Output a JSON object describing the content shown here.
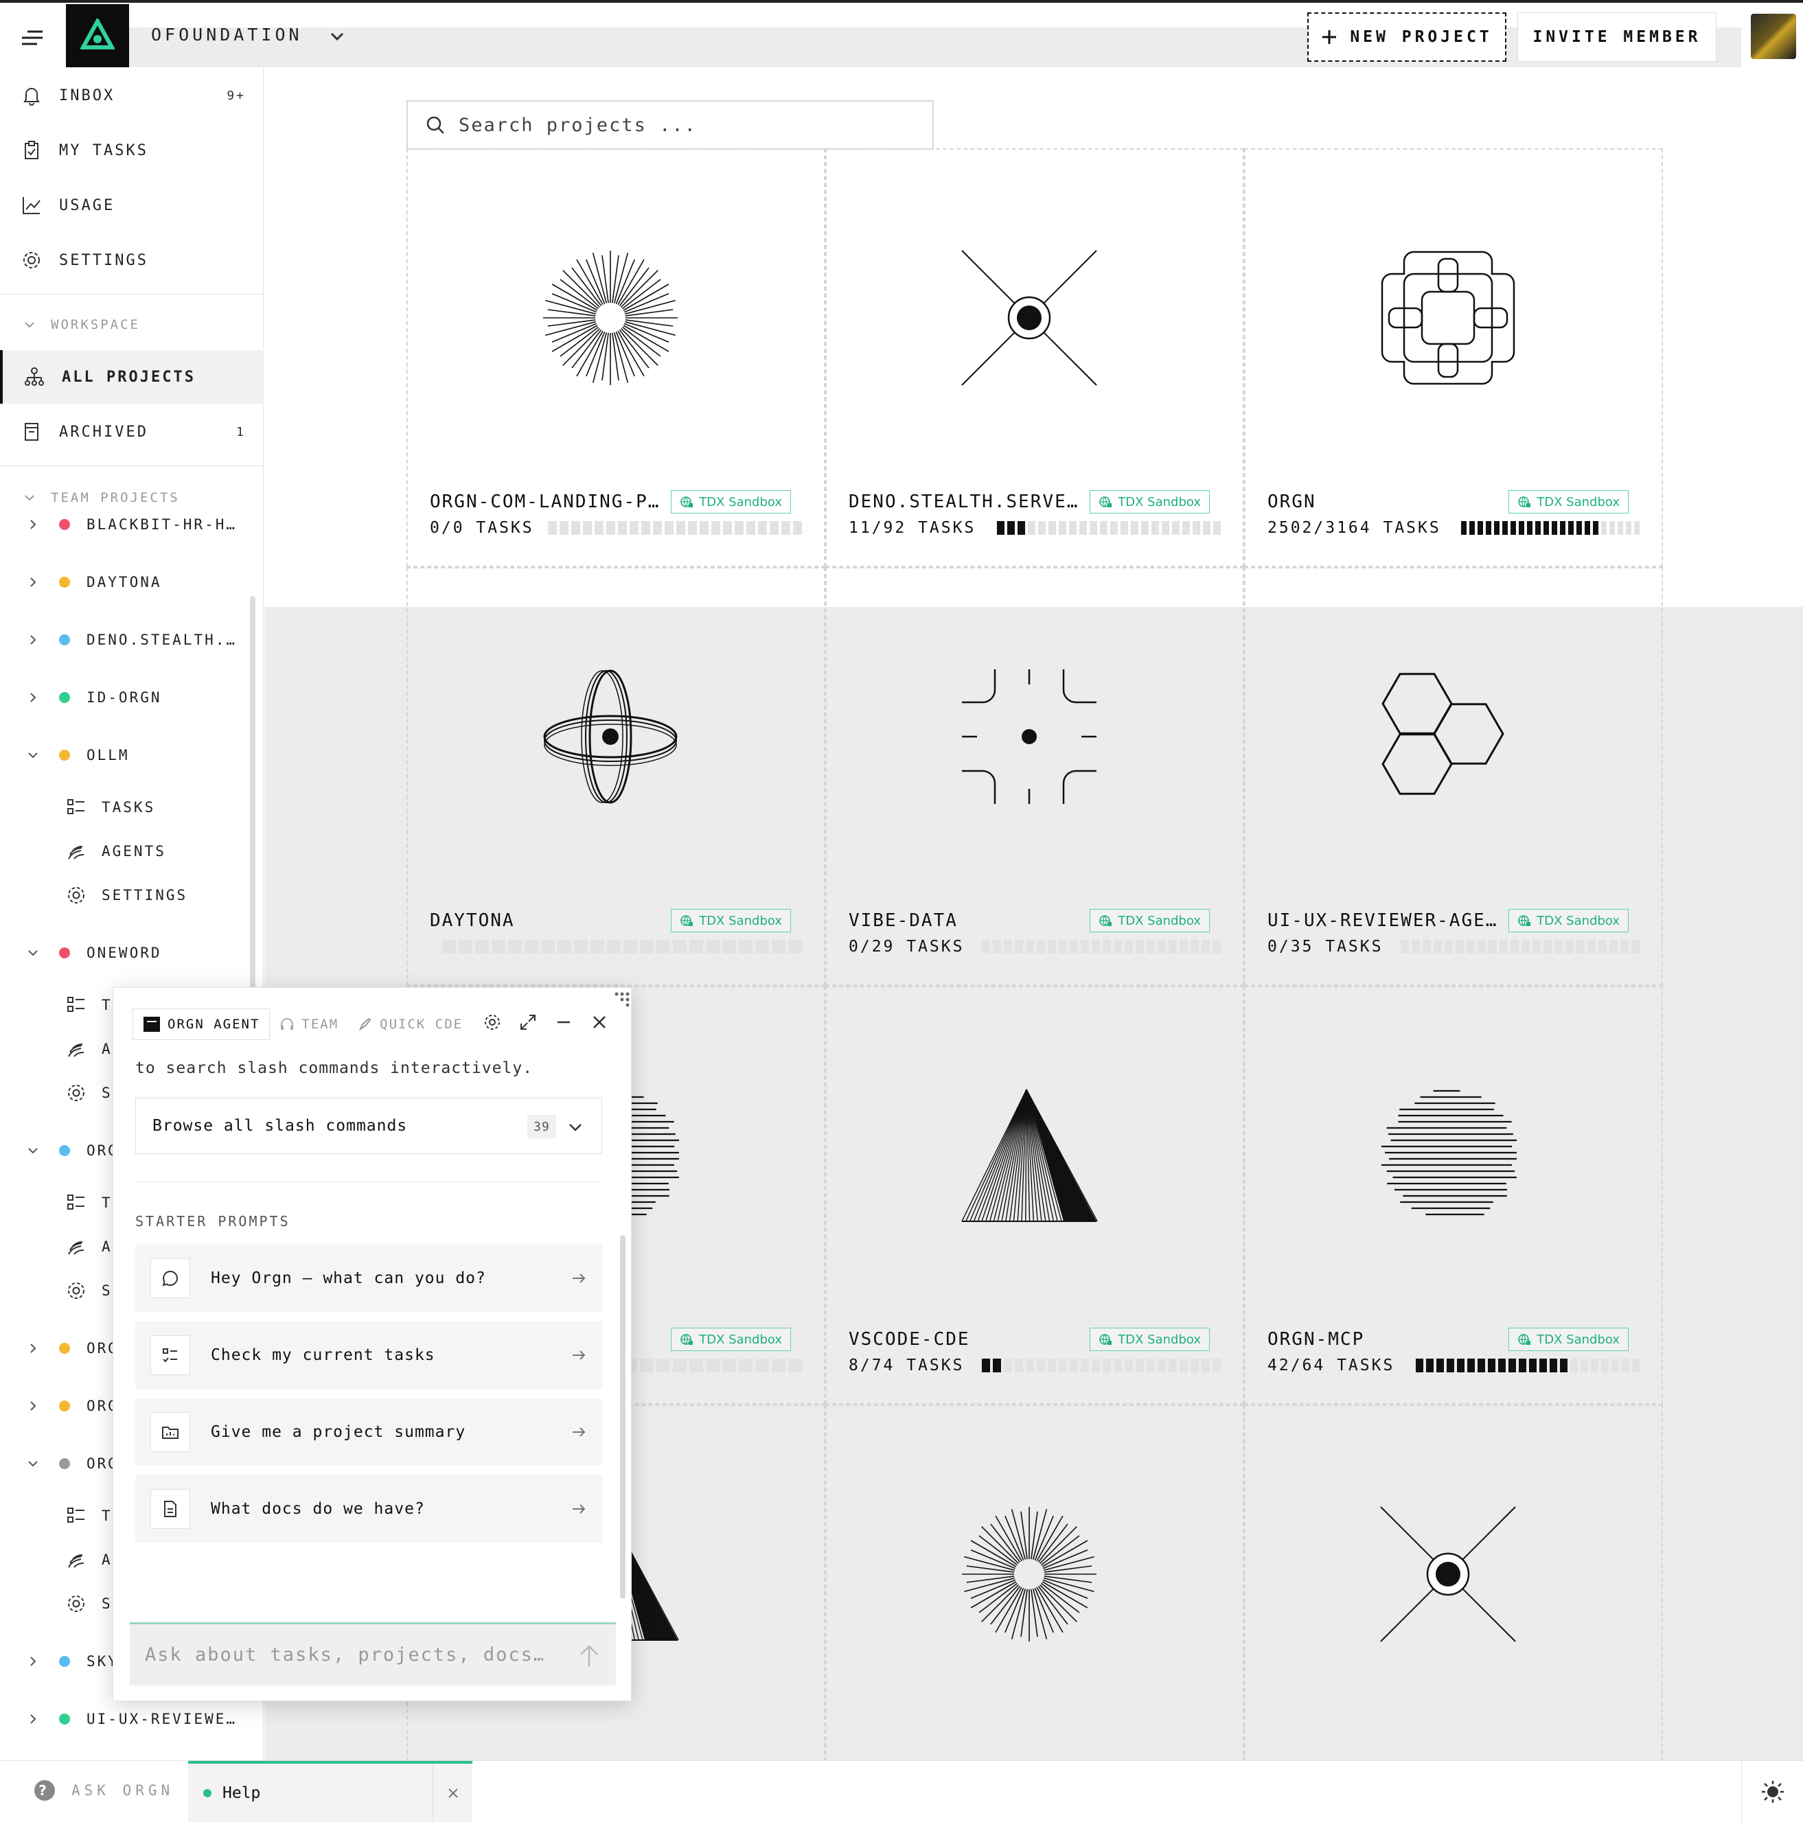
{
  "topbar": {
    "org_name": "OFOUNDATION",
    "new_project_label": "NEW PROJECT",
    "invite_member_label": "INVITE MEMBER"
  },
  "sidebar": {
    "nav": [
      {
        "label": "INBOX",
        "count": "9+",
        "icon": "bell-icon"
      },
      {
        "label": "MY TASKS",
        "icon": "clipboard-icon"
      },
      {
        "label": "USAGE",
        "icon": "chart-line-icon"
      },
      {
        "label": "SETTINGS",
        "icon": "gear-icon"
      }
    ],
    "workspace_label": "WORKSPACE",
    "workspace_items": [
      {
        "label": "ALL PROJECTS",
        "icon": "hierarchy-icon"
      },
      {
        "label": "ARCHIVED",
        "count": "1",
        "icon": "archive-icon"
      }
    ],
    "team_projects_label": "TEAM PROJECTS",
    "projects": [
      {
        "label": "BLACKBIT-HR-H…",
        "color": "#f0506e",
        "expanded": false
      },
      {
        "label": "DAYTONA",
        "color": "#f5b731",
        "expanded": false
      },
      {
        "label": "DENO.STEALTH.…",
        "color": "#5bbcf0",
        "expanded": false
      },
      {
        "label": "ID-ORGN",
        "color": "#2fcf8e",
        "expanded": false
      },
      {
        "label": "OLLM",
        "color": "#f5b731",
        "expanded": true
      },
      {
        "label": "ONEWORD",
        "color": "#f0506e",
        "expanded": true
      },
      {
        "label": "ORG",
        "color": "#5bbcf0",
        "expanded": true
      },
      {
        "label": "ORG",
        "color": "#f5b731",
        "expanded": false
      },
      {
        "label": "ORG",
        "color": "#f5b731",
        "expanded": false
      },
      {
        "label": "ORG",
        "color": "#9a9a9a",
        "expanded": true
      },
      {
        "label": "SKY",
        "color": "#5bbcf0",
        "expanded": false
      },
      {
        "label": "UI-UX-REVIEWE…",
        "color": "#2fcf8e",
        "expanded": false
      }
    ],
    "sub_items": {
      "tasks": "TASKS",
      "agents": "AGENTS",
      "settings": "SETTINGS",
      "tasks_short": "TA",
      "agents_short": "AG",
      "settings_short": "SE"
    }
  },
  "main": {
    "search_placeholder": "Search projects ...",
    "badge_label": "TDX Sandbox",
    "cards": [
      {
        "title": "ORGN-COM-LANDING-P…",
        "tasks": "0/0 TASKS",
        "progress": 0,
        "art": "sunburst"
      },
      {
        "title": "DENO.STEALTH.SERVE…",
        "tasks": "11/92 TASKS",
        "progress": 0.12,
        "art": "x-eye"
      },
      {
        "title": "ORGN",
        "tasks": "2502/3164 TASKS",
        "progress": 0.79,
        "art": "knot"
      },
      {
        "title": "DAYTONA",
        "tasks": "",
        "progress": 0,
        "art": "orbit"
      },
      {
        "title": "VIBE-DATA",
        "tasks": "0/29 TASKS",
        "progress": 0,
        "art": "crosshair"
      },
      {
        "title": "UI-UX-REVIEWER-AGE…",
        "tasks": "0/35 TASKS",
        "progress": 0,
        "art": "hexagons"
      },
      {
        "title": "",
        "tasks": "",
        "progress": 0,
        "art": "striped-circle"
      },
      {
        "title": "VSCODE-CDE",
        "tasks": "8/74 TASKS",
        "progress": 0.11,
        "art": "triangle"
      },
      {
        "title": "ORGN-MCP",
        "tasks": "42/64 TASKS",
        "progress": 0.66,
        "art": "striped-circle"
      },
      {
        "title": "",
        "tasks": "",
        "progress": 0,
        "art": "triangle"
      },
      {
        "title": "",
        "tasks": "",
        "progress": 0,
        "art": "sunburst"
      },
      {
        "title": "",
        "tasks": "",
        "progress": 0,
        "art": "x-eye"
      }
    ]
  },
  "chat": {
    "tabs": [
      "ORGN AGENT",
      "TEAM",
      "QUICK CDE"
    ],
    "intro_text": "to search slash commands interactively.",
    "browse_label": "Browse all slash commands",
    "browse_count": "39",
    "starter_heading": "STARTER PROMPTS",
    "prompts": [
      {
        "text": "Hey Orgn — what can you do?",
        "icon": "chat-bubble-icon"
      },
      {
        "text": "Check my current tasks",
        "icon": "task-list-icon"
      },
      {
        "text": "Give me a project summary",
        "icon": "folder-chart-icon"
      },
      {
        "text": "What docs do we have?",
        "icon": "document-icon"
      }
    ],
    "input_placeholder": "Ask about tasks, projects, docs…"
  },
  "bottombar": {
    "ask_label": "ASK ORGN",
    "help_tab_label": "Help"
  },
  "colors": {
    "accent_green": "#2bbf86",
    "badge_green": "#1fb07c",
    "progress_on": "#111111",
    "progress_off": "#e2e2e2"
  }
}
